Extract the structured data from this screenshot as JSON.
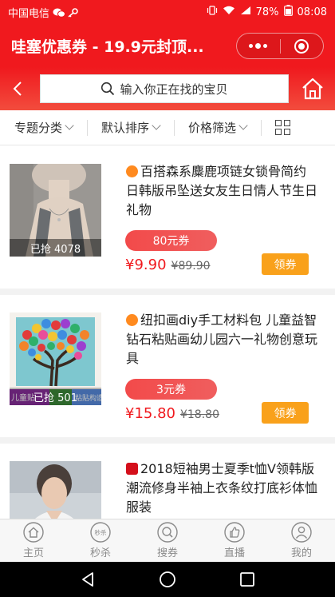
{
  "statusbar": {
    "carrier": "中国电信",
    "battery": "78%",
    "time": "08:08"
  },
  "titlebar": {
    "title": "哇塞优惠券 - 19.9元封顶..."
  },
  "search": {
    "placeholder": "输入你正在找的宝贝"
  },
  "filters": [
    {
      "label": "专题分类"
    },
    {
      "label": "默认排序"
    },
    {
      "label": "价格筛选"
    }
  ],
  "products": [
    {
      "source": "taobao",
      "title": "百搭森系麋鹿项链女锁骨简约日韩版吊坠送女友生日情人节生日礼物",
      "sold": "已抢 4078",
      "coupon": "80元券",
      "price": "¥9.90",
      "original_price": "¥89.90",
      "button": "领券"
    },
    {
      "source": "taobao",
      "title": "纽扣画diy手工材料包 儿童益智钻石粘贴画幼儿园六一礼物创意玩具",
      "sold": "已抢 501",
      "coupon": "3元券",
      "price": "¥15.80",
      "original_price": "¥18.80",
      "button": "领券",
      "image_banner_left": "儿童贴",
      "image_banner_right": "粘贴构造"
    },
    {
      "source": "tmall",
      "title": "2018短袖男士夏季t恤V领韩版潮流修身半袖上衣条纹打底衫体恤服装"
    }
  ],
  "tabs": [
    {
      "label": "主页",
      "icon": "home-icon"
    },
    {
      "label": "秒杀",
      "icon": "flash-sale-icon",
      "icon_text": "秒杀"
    },
    {
      "label": "搜券",
      "icon": "coupon-search-icon"
    },
    {
      "label": "直播",
      "icon": "thumbs-up-icon"
    },
    {
      "label": "我的",
      "icon": "user-icon"
    }
  ],
  "colors": {
    "brand_red": "#f0191e",
    "coupon_button": "#f9a11b",
    "price_red": "#f0191e"
  }
}
